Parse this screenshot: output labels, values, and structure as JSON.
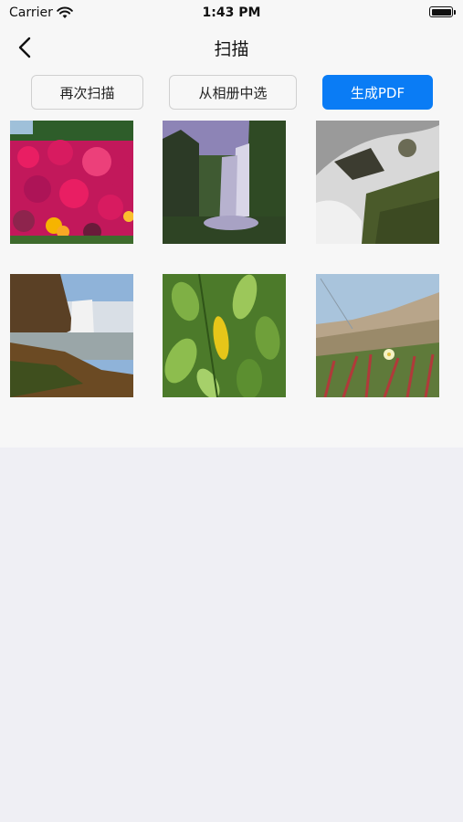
{
  "status_bar": {
    "carrier": "Carrier",
    "time": "1:43 PM",
    "wifi_icon": "wifi-icon",
    "battery_icon": "battery-icon"
  },
  "nav": {
    "title": "扫描",
    "back_icon": "chevron-left-icon"
  },
  "actions": {
    "rescan_label": "再次扫描",
    "album_label": "从相册中选",
    "pdf_label": "生成PDF"
  },
  "photos": [
    {
      "id": "flowers",
      "description_key": "pink-flowers-photo"
    },
    {
      "id": "waterfall",
      "description_key": "waterfall-photo"
    },
    {
      "id": "stream",
      "description_key": "stream-rocks-photo"
    },
    {
      "id": "cliff-falls",
      "description_key": "cliff-waterfall-photo"
    },
    {
      "id": "leaves",
      "description_key": "green-leaves-photo"
    },
    {
      "id": "dune-flower",
      "description_key": "dune-flower-photo"
    }
  ],
  "colors": {
    "accent": "#0a7cf5",
    "header_bg": "#f7f7f7",
    "page_bg": "#efeff4"
  }
}
